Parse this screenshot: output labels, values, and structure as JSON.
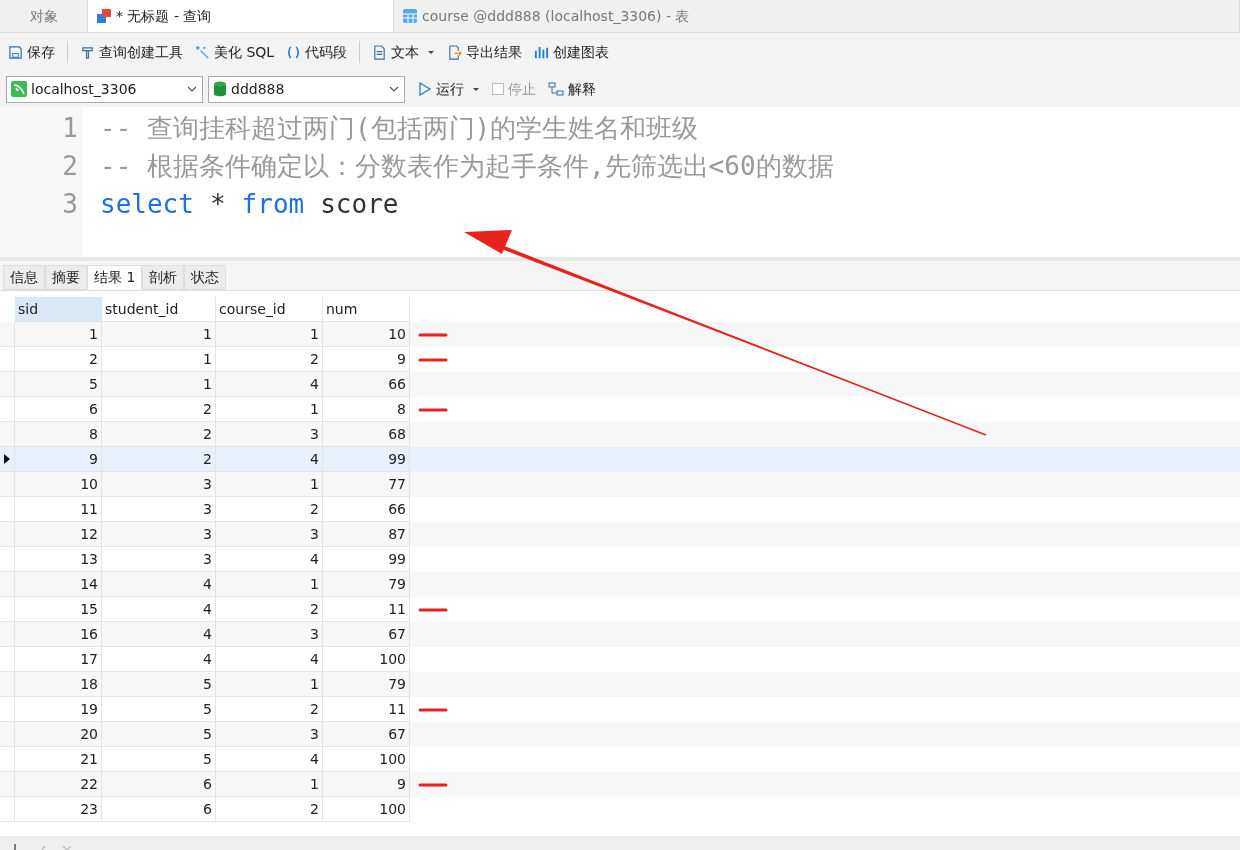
{
  "doc_tabs": [
    {
      "label": "对象",
      "kind": "plain",
      "selected": false
    },
    {
      "label": "* 无标题 - 查询",
      "kind": "query",
      "selected": true
    },
    {
      "label": "course @ddd888 (localhost_3306) - 表",
      "kind": "table",
      "selected": false
    }
  ],
  "toolbar": [
    {
      "label": "保存",
      "kind": "save"
    },
    {
      "label": "查询创建工具",
      "kind": "builder"
    },
    {
      "label": "美化 SQL",
      "kind": "beautify"
    },
    {
      "label": "代码段",
      "kind": "snippet"
    },
    {
      "label": "文本",
      "kind": "text"
    },
    {
      "label": "导出结果",
      "kind": "export"
    },
    {
      "label": "创建图表",
      "kind": "chart"
    }
  ],
  "connection": "localhost_3306",
  "database": "ddd888",
  "run_bar": [
    {
      "label": "运行",
      "kind": "run",
      "disabled": false
    },
    {
      "label": "停止",
      "kind": "stop",
      "disabled": true
    },
    {
      "label": "解释",
      "kind": "explain",
      "disabled": false
    }
  ],
  "editor_lines": [
    {
      "number": "1",
      "text": "-- 查询挂科超过两门(包括两门)的学生姓名和班级",
      "kind": "comment"
    },
    {
      "number": "2",
      "text": "-- 根据条件确定以：分数表作为起手条件,先筛选出<60的数据",
      "kind": "comment"
    },
    {
      "number": "3",
      "kind": "code",
      "tokens": [
        {
          "text": "select",
          "kind": "keyword"
        },
        {
          "text": "*",
          "kind": "plain"
        },
        {
          "text": "from",
          "kind": "keyword"
        },
        {
          "text": "score",
          "kind": "plain"
        }
      ]
    }
  ],
  "result_tabs": [
    {
      "label": "信息",
      "selected": false
    },
    {
      "label": "摘要",
      "selected": false
    },
    {
      "label": "结果 1",
      "selected": true
    },
    {
      "label": "剖析",
      "selected": false
    },
    {
      "label": "状态",
      "selected": false
    }
  ],
  "table": {
    "columns": [
      "sid",
      "student_id",
      "course_id",
      "num"
    ],
    "rows": [
      {
        "cells": [
          "1",
          "1",
          "1",
          "10"
        ],
        "selected": false,
        "marked": true
      },
      {
        "cells": [
          "2",
          "1",
          "2",
          "9"
        ],
        "selected": false,
        "marked": true
      },
      {
        "cells": [
          "5",
          "1",
          "4",
          "66"
        ],
        "selected": false,
        "marked": false
      },
      {
        "cells": [
          "6",
          "2",
          "1",
          "8"
        ],
        "selected": false,
        "marked": true
      },
      {
        "cells": [
          "8",
          "2",
          "3",
          "68"
        ],
        "selected": false,
        "marked": false
      },
      {
        "cells": [
          "9",
          "2",
          "4",
          "99"
        ],
        "selected": true,
        "marked": false
      },
      {
        "cells": [
          "10",
          "3",
          "1",
          "77"
        ],
        "selected": false,
        "marked": false
      },
      {
        "cells": [
          "11",
          "3",
          "2",
          "66"
        ],
        "selected": false,
        "marked": false
      },
      {
        "cells": [
          "12",
          "3",
          "3",
          "87"
        ],
        "selected": false,
        "marked": false
      },
      {
        "cells": [
          "13",
          "3",
          "4",
          "99"
        ],
        "selected": false,
        "marked": false
      },
      {
        "cells": [
          "14",
          "4",
          "1",
          "79"
        ],
        "selected": false,
        "marked": false
      },
      {
        "cells": [
          "15",
          "4",
          "2",
          "11"
        ],
        "selected": false,
        "marked": true
      },
      {
        "cells": [
          "16",
          "4",
          "3",
          "67"
        ],
        "selected": false,
        "marked": false
      },
      {
        "cells": [
          "17",
          "4",
          "4",
          "100"
        ],
        "selected": false,
        "marked": false
      },
      {
        "cells": [
          "18",
          "5",
          "1",
          "79"
        ],
        "selected": false,
        "marked": false
      },
      {
        "cells": [
          "19",
          "5",
          "2",
          "11"
        ],
        "selected": false,
        "marked": true
      },
      {
        "cells": [
          "20",
          "5",
          "3",
          "67"
        ],
        "selected": false,
        "marked": false
      },
      {
        "cells": [
          "21",
          "5",
          "4",
          "100"
        ],
        "selected": false,
        "marked": false
      },
      {
        "cells": [
          "22",
          "6",
          "1",
          "9"
        ],
        "selected": false,
        "marked": true
      },
      {
        "cells": [
          "23",
          "6",
          "2",
          "100"
        ],
        "selected": false,
        "marked": false
      }
    ]
  }
}
